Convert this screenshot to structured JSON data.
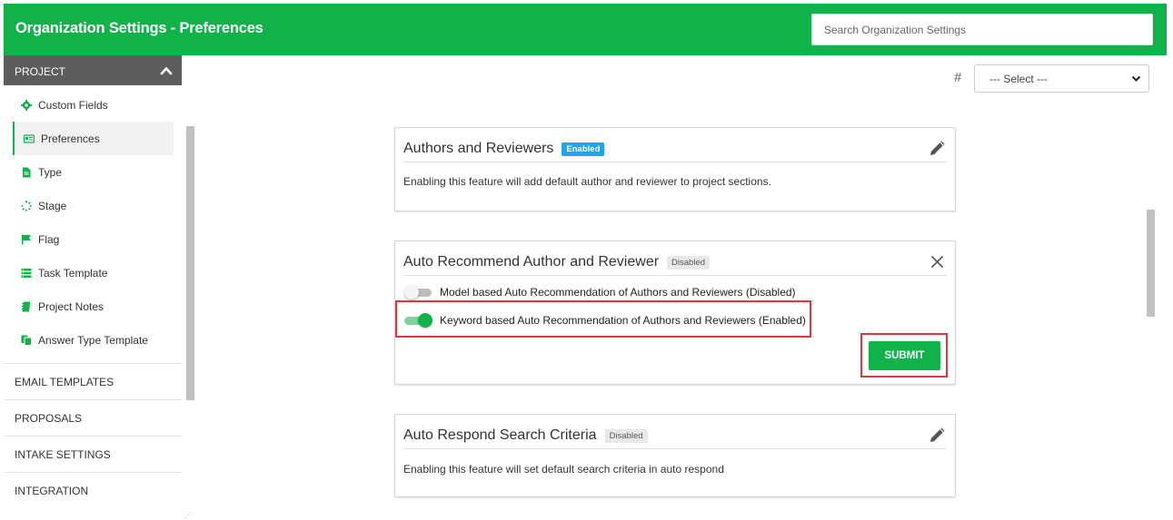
{
  "header": {
    "title": "Organization Settings - Preferences",
    "search_placeholder": "Search Organization Settings"
  },
  "sidebar": {
    "project_label": "PROJECT",
    "items": [
      {
        "label": "Custom Fields",
        "icon": "gear-icon"
      },
      {
        "label": "Preferences",
        "icon": "id-card-icon"
      },
      {
        "label": "Type",
        "icon": "document-icon"
      },
      {
        "label": "Stage",
        "icon": "spinner-icon"
      },
      {
        "label": "Flag",
        "icon": "flag-icon"
      },
      {
        "label": "Task Template",
        "icon": "list-icon"
      },
      {
        "label": "Project Notes",
        "icon": "notebook-icon"
      },
      {
        "label": "Answer Type Template",
        "icon": "copy-icon"
      }
    ],
    "sections": [
      "EMAIL TEMPLATES",
      "PROPOSALS",
      "INTAKE SETTINGS",
      "INTEGRATION"
    ]
  },
  "filter": {
    "hash": "#",
    "select_value": "--- Select ---"
  },
  "cards": {
    "authors": {
      "title": "Authors and Reviewers",
      "status": "Enabled",
      "description": "Enabling this feature will add default author and reviewer to project sections."
    },
    "auto_recommend": {
      "title": "Auto Recommend Author and Reviewer",
      "status": "Disabled",
      "options": [
        {
          "label": "Model based Auto Recommendation of Authors and Reviewers (Disabled)",
          "on": false
        },
        {
          "label": "Keyword based Auto Recommendation of Authors and Reviewers (Enabled)",
          "on": true
        }
      ],
      "submit_label": "SUBMIT"
    },
    "auto_respond": {
      "title": "Auto Respond Search Criteria",
      "status": "Disabled",
      "description": "Enabling this feature will set default search criteria in auto respond"
    }
  },
  "colors": {
    "brand": "#12b24b",
    "enabled_badge": "#1ea7e4",
    "highlight": "#e0383a"
  }
}
